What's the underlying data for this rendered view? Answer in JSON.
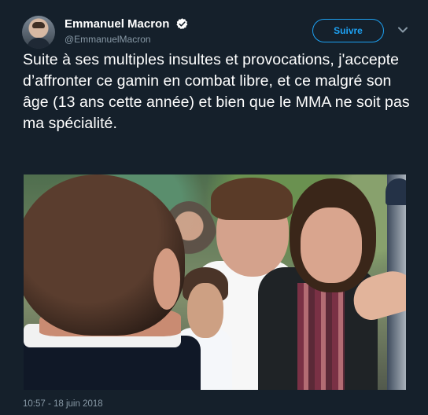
{
  "user": {
    "name": "Emmanuel Macron",
    "handle": "@EmmanuelMacron"
  },
  "actions": {
    "follow_label": "Suivre"
  },
  "tweet": {
    "text": "Suite à ses multiples insultes et provocations, j'accepte d’affronter ce gamin en combat libre, et ce malgré son âge (13 ans cette année) et bien que le MMA ne soit pas ma spécialité.",
    "timestamp": "10:57 - 18 juin 2018"
  },
  "colors": {
    "background": "#15202b",
    "accent": "#1da1f2",
    "secondary_text": "#8899a6"
  },
  "icons": {
    "verified": "verified-badge-icon",
    "more": "chevron-down-icon"
  }
}
